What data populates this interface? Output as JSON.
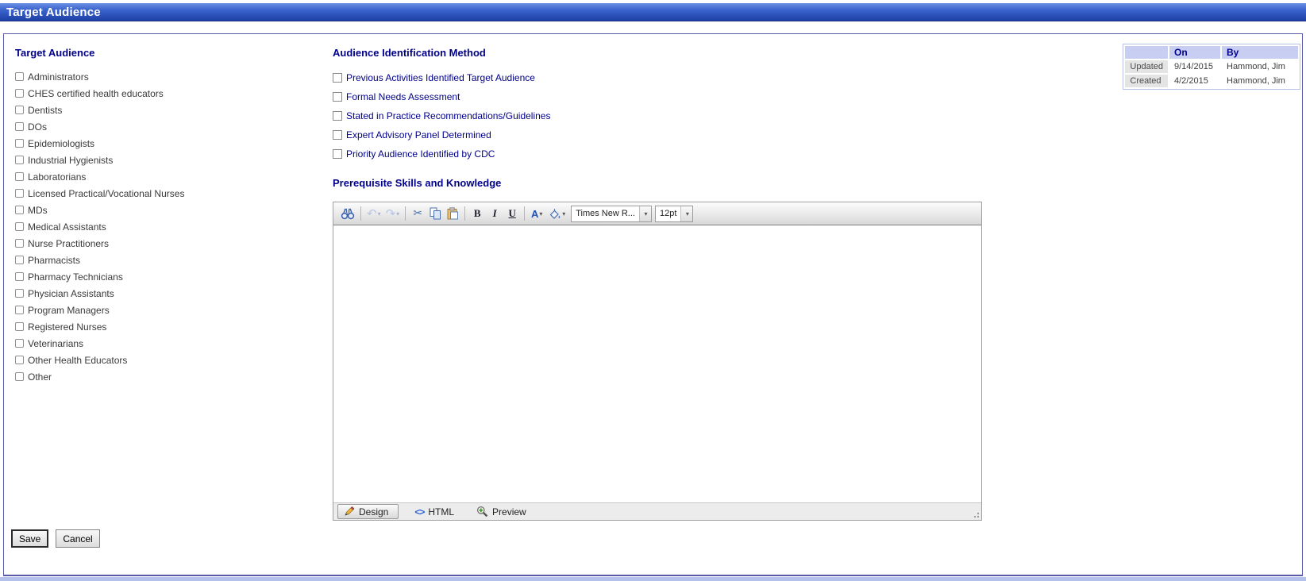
{
  "page": {
    "title": "Target Audience"
  },
  "target_audience": {
    "heading": "Target Audience",
    "options": [
      "Administrators",
      "CHES certified health educators",
      "Dentists",
      "DOs",
      "Epidemiologists",
      "Industrial Hygienists",
      "Laboratorians",
      "Licensed Practical/Vocational Nurses",
      "MDs",
      "Medical Assistants",
      "Nurse Practitioners",
      "Pharmacists",
      "Pharmacy Technicians",
      "Physician Assistants",
      "Program Managers",
      "Registered Nurses",
      "Veterinarians",
      "Other Health Educators",
      "Other"
    ]
  },
  "audience_identification": {
    "heading": "Audience Identification Method",
    "options": [
      "Previous Activities Identified Target Audience",
      "Formal Needs Assessment",
      "Stated in Practice Recommendations/Guidelines",
      "Expert Advisory Panel Determined",
      "Priority Audience Identified by CDC"
    ]
  },
  "prerequisite": {
    "heading": "Prerequisite Skills and Knowledge"
  },
  "editor": {
    "toolbar": {
      "bold": "B",
      "italic": "I",
      "underline": "U",
      "font_color": "A",
      "font_name": "Times New R...",
      "font_size": "12pt"
    },
    "content": "",
    "modes": {
      "design": "Design",
      "html": "HTML",
      "preview": "Preview"
    },
    "active_mode": "Design"
  },
  "audit": {
    "columns": {
      "label": "",
      "on": "On",
      "by": "By"
    },
    "rows": [
      {
        "label": "Updated",
        "on": "9/14/2015",
        "by": "Hammond, Jim"
      },
      {
        "label": "Created",
        "on": "4/2/2015",
        "by": "Hammond, Jim"
      }
    ]
  },
  "actions": {
    "save": "Save",
    "cancel": "Cancel"
  },
  "colors": {
    "heading_navy": "#00008B",
    "header_bar_top": "#6a8fe2",
    "header_bar_bottom": "#1e3fa6",
    "panel_border": "#5a5aab",
    "audit_header_bg": "#c7cef1",
    "audit_label_bg": "#e4e4e4",
    "footer_strip": "#b3c1eb"
  }
}
